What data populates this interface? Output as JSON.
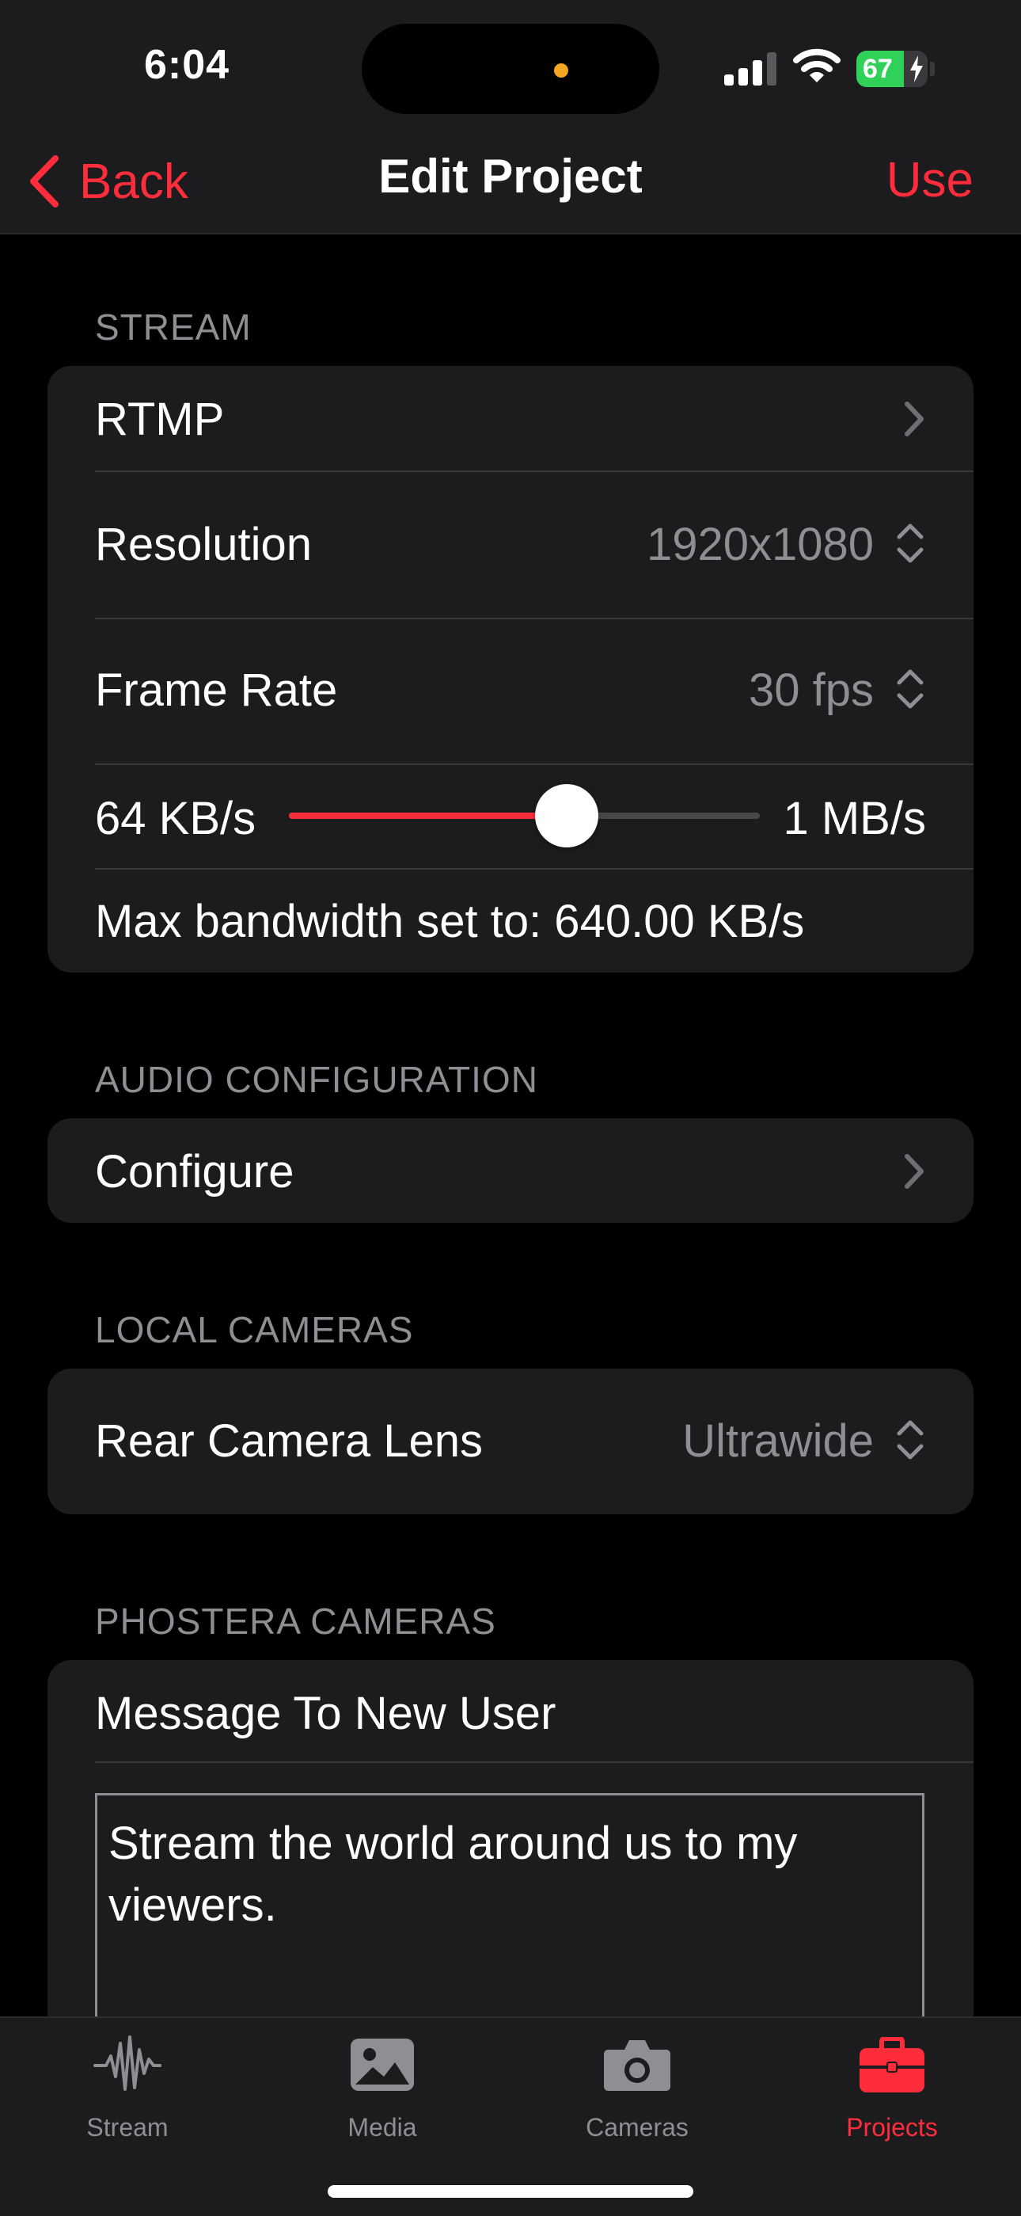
{
  "status_bar": {
    "time": "6:04",
    "battery_level": "67",
    "battery_fraction": 0.67
  },
  "nav": {
    "back_label": "Back",
    "title": "Edit Project",
    "action_label": "Use"
  },
  "sections": {
    "stream": {
      "header": "STREAM",
      "rtmp_label": "RTMP",
      "resolution_label": "Resolution",
      "resolution_value": "1920x1080",
      "frame_rate_label": "Frame Rate",
      "frame_rate_value": "30 fps",
      "bandwidth_min_label": "64 KB/s",
      "bandwidth_max_label": "1 MB/s",
      "bandwidth_slider_fraction": 0.59,
      "bandwidth_status": "Max bandwidth set to: 640.00 KB/s"
    },
    "audio": {
      "header": "AUDIO CONFIGURATION",
      "configure_label": "Configure"
    },
    "local_cameras": {
      "header": "LOCAL CAMERAS",
      "rear_lens_label": "Rear Camera Lens",
      "rear_lens_value": "Ultrawide"
    },
    "phostera_cameras": {
      "header": "PHOSTERA CAMERAS",
      "message_label": "Message To New User",
      "message_value": "Stream the world around us to my viewers."
    }
  },
  "tabbar": {
    "tabs": [
      {
        "label": "Stream",
        "icon": "waveform-icon",
        "active": false
      },
      {
        "label": "Media",
        "icon": "photo-icon",
        "active": false
      },
      {
        "label": "Cameras",
        "icon": "camera-icon",
        "active": false
      },
      {
        "label": "Projects",
        "icon": "briefcase-icon",
        "active": true
      }
    ]
  },
  "colors": {
    "accent": "#ff2d3b",
    "background": "#000000",
    "card": "#1c1c1e",
    "secondary_text": "#8e8e93",
    "battery": "#30d158"
  }
}
